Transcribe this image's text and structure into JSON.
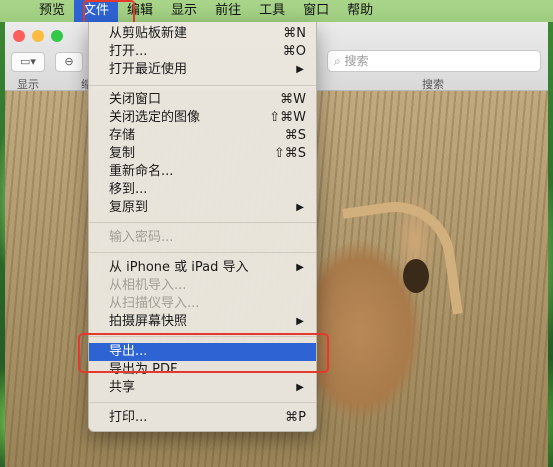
{
  "menubar": {
    "apple_glyph": "",
    "items": [
      "预览",
      "文件",
      "编辑",
      "显示",
      "前往",
      "工具",
      "窗口",
      "帮助"
    ],
    "active_index": 1
  },
  "window": {
    "toolbar": {
      "view_label": "显示",
      "zoom_label_partial": "缩",
      "search_placeholder": "搜索",
      "search_label": "搜索"
    }
  },
  "file_menu": {
    "items": [
      {
        "label": "从剪贴板新建",
        "shortcut": "⌘N",
        "enabled": true
      },
      {
        "label": "打开...",
        "shortcut": "⌘O",
        "enabled": true
      },
      {
        "label": "打开最近使用",
        "submenu": true,
        "enabled": true
      },
      {
        "label": "关闭窗口",
        "shortcut": "⌘W",
        "enabled": true
      },
      {
        "label": "关闭选定的图像",
        "shortcut": "⇧⌘W",
        "enabled": true
      },
      {
        "label": "存储",
        "shortcut": "⌘S",
        "enabled": true
      },
      {
        "label": "复制",
        "shortcut": "⇧⌘S",
        "enabled": true
      },
      {
        "label": "重新命名...",
        "enabled": true
      },
      {
        "label": "移到...",
        "enabled": true
      },
      {
        "label": "复原到",
        "submenu": true,
        "enabled": true
      },
      {
        "label": "输入密码...",
        "enabled": false
      },
      {
        "label": "从 iPhone 或 iPad 导入",
        "submenu": true,
        "enabled": true
      },
      {
        "label": "从相机导入...",
        "enabled": false
      },
      {
        "label": "从扫描仪导入...",
        "enabled": false
      },
      {
        "label": "拍摄屏幕快照",
        "submenu": true,
        "enabled": true
      },
      {
        "label": "导出...",
        "enabled": true,
        "highlighted": true
      },
      {
        "label": "导出为 PDF...",
        "enabled": true
      },
      {
        "label": "共享",
        "submenu": true,
        "enabled": true
      },
      {
        "label": "打印...",
        "shortcut": "⌘P",
        "enabled": true
      }
    ],
    "submenu_arrow": "▶"
  },
  "colors": {
    "highlight": "#2e63d3",
    "annotation_red": "#e43a2d"
  }
}
